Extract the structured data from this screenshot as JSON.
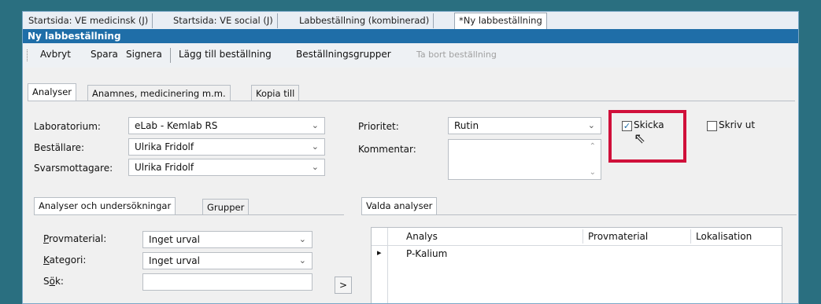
{
  "doc_tabs": [
    {
      "label": "Startsida: VE medicinsk (J)"
    },
    {
      "label": "Startsida: VE social (J)"
    },
    {
      "label": "Labbeställning (kombinerad)"
    },
    {
      "label": "*Ny labbeställning"
    }
  ],
  "window_title": "Ny labbeställning",
  "toolbar": {
    "cancel": "Avbryt",
    "save": "Spara",
    "sign": "Signera",
    "add_order": "Lägg till beställning",
    "order_groups": "Beställningsgrupper",
    "remove_order": "Ta bort beställning"
  },
  "main_tabs": [
    {
      "label": "Analyser"
    },
    {
      "label": "Anamnes, medicinering m.m."
    },
    {
      "label": "Kopia till"
    }
  ],
  "form": {
    "laboratory_label": "Laboratorium:",
    "laboratory_value": "eLab - Kemlab RS",
    "orderer_label": "Beställare:",
    "orderer_value": "Ulrika Fridolf",
    "recipient_label": "Svarsmottagare:",
    "recipient_value": "Ulrika Fridolf",
    "priority_label": "Prioritet:",
    "priority_value": "Rutin",
    "comment_label": "Kommentar:",
    "send_label": "Skicka",
    "print_label": "Skriv ut"
  },
  "sub_tabs": [
    {
      "label": "Analyser och undersökningar"
    },
    {
      "label": "Grupper"
    }
  ],
  "filters": {
    "material_label": "Provmaterial:",
    "material_value": "Inget urval",
    "category_label": "Kategori:",
    "category_value": "Inget urval",
    "search_label": "Sök:"
  },
  "add_arrow": ">",
  "selected_tab": "Valda analyser",
  "grid": {
    "columns": [
      "Analys",
      "Provmaterial",
      "Lokalisation"
    ],
    "rows": [
      {
        "analys": "P-Kalium"
      }
    ]
  },
  "colors": {
    "accent": "#1f6ea8",
    "highlight": "#d0103a",
    "background": "#2a6f80"
  }
}
